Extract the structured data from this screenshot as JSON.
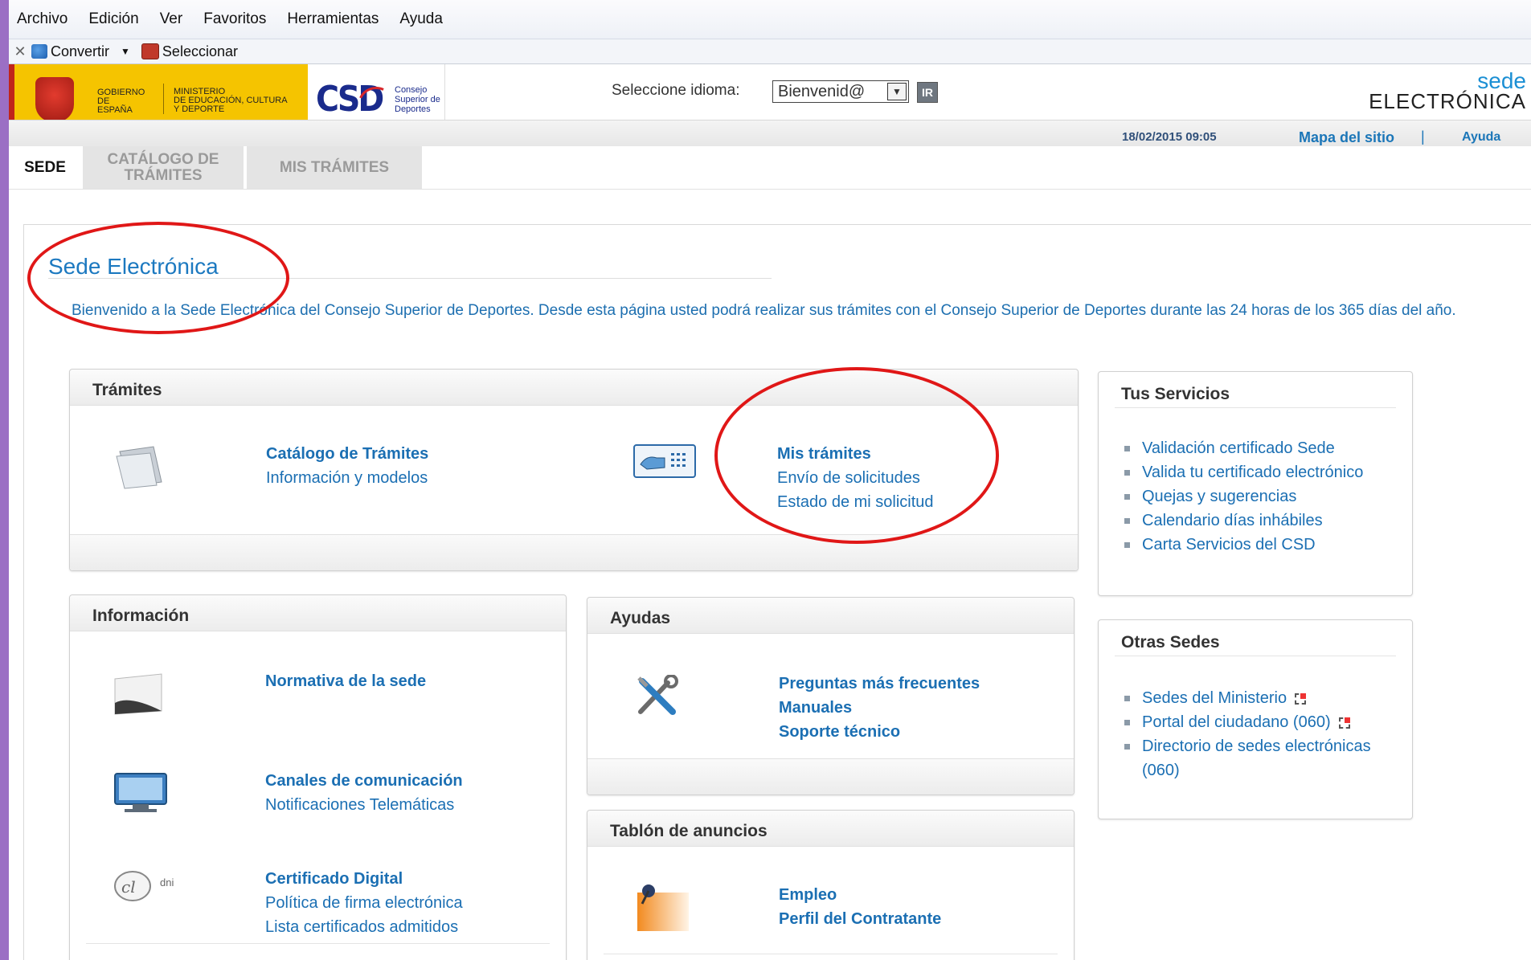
{
  "menubar": {
    "items": [
      "Archivo",
      "Edición",
      "Ver",
      "Favoritos",
      "Herramientas",
      "Ayuda"
    ]
  },
  "toolbar": {
    "convert_label": "Convertir",
    "select_label": "Seleccionar"
  },
  "header": {
    "gob_line1": "GOBIERNO",
    "gob_line2": "DE ESPAÑA",
    "ministry_line1": "MINISTERIO",
    "ministry_line2": "DE EDUCACIÓN, CULTURA",
    "ministry_line3": "Y DEPORTE",
    "csd_logo": "CSD",
    "csd_sub1": "Consejo",
    "csd_sub2": "Superior de",
    "csd_sub3": "Deportes",
    "lang_label": "Seleccione idioma:",
    "lang_value": "Bienvenid@",
    "ir_label": "IR",
    "sede_logo_top": "sede",
    "sede_logo_bottom": "ELECTRÓNICA",
    "datetime": "18/02/2015 09:05",
    "sitemap": "Mapa del sitio",
    "separator": "|",
    "help": "Ayuda"
  },
  "tabs": [
    {
      "label": "SEDE"
    },
    {
      "label": "CATÁLOGO DE TRÁMITES"
    },
    {
      "label": "MIS TRÁMITES"
    }
  ],
  "main": {
    "title": "Sede Electrónica",
    "intro": "Bienvenido a la Sede Electrónica del Consejo Superior de Deportes. Desde esta página usted podrá realizar sus trámites con el Consejo Superior de Deportes durante las 24 horas de los 365 días del año."
  },
  "tramites": {
    "title": "Trámites",
    "catalogo": {
      "title": "Catálogo de Trámites",
      "links": [
        "Información y modelos"
      ]
    },
    "mis": {
      "title": "Mis trámites",
      "links": [
        "Envío de solicitudes",
        "Estado de mi solicitud"
      ]
    }
  },
  "informacion": {
    "title": "Información",
    "items": [
      {
        "title": "Normativa de la sede",
        "links": []
      },
      {
        "title": "Canales de comunicación",
        "links": [
          "Notificaciones Telemáticas"
        ]
      },
      {
        "title": "Certificado Digital",
        "links": [
          "Política de firma electrónica",
          "Lista certificados admitidos"
        ]
      }
    ],
    "dni_label": "dni"
  },
  "ayudas": {
    "title": "Ayudas",
    "links": [
      "Preguntas más frecuentes",
      "Manuales",
      "Soporte técnico"
    ]
  },
  "tablon": {
    "title": "Tablón de anuncios",
    "links": [
      "Empleo",
      "Perfil del Contratante"
    ]
  },
  "servicios": {
    "title": "Tus Servicios",
    "items": [
      "Validación certificado Sede",
      "Valida tu certificado electrónico",
      "Quejas y sugerencias",
      "Calendario días inhábiles",
      "Carta Servicios del CSD"
    ]
  },
  "otras": {
    "title": "Otras Sedes",
    "items": [
      "Sedes del Ministerio",
      "Portal del ciudadano (060)",
      "Directorio de sedes electrónicas",
      "(060)"
    ]
  },
  "colors": {
    "link": "#1b6fb3",
    "title": "#1c79c0",
    "annotation": "#e01717",
    "frame": "#9b6fc4"
  }
}
